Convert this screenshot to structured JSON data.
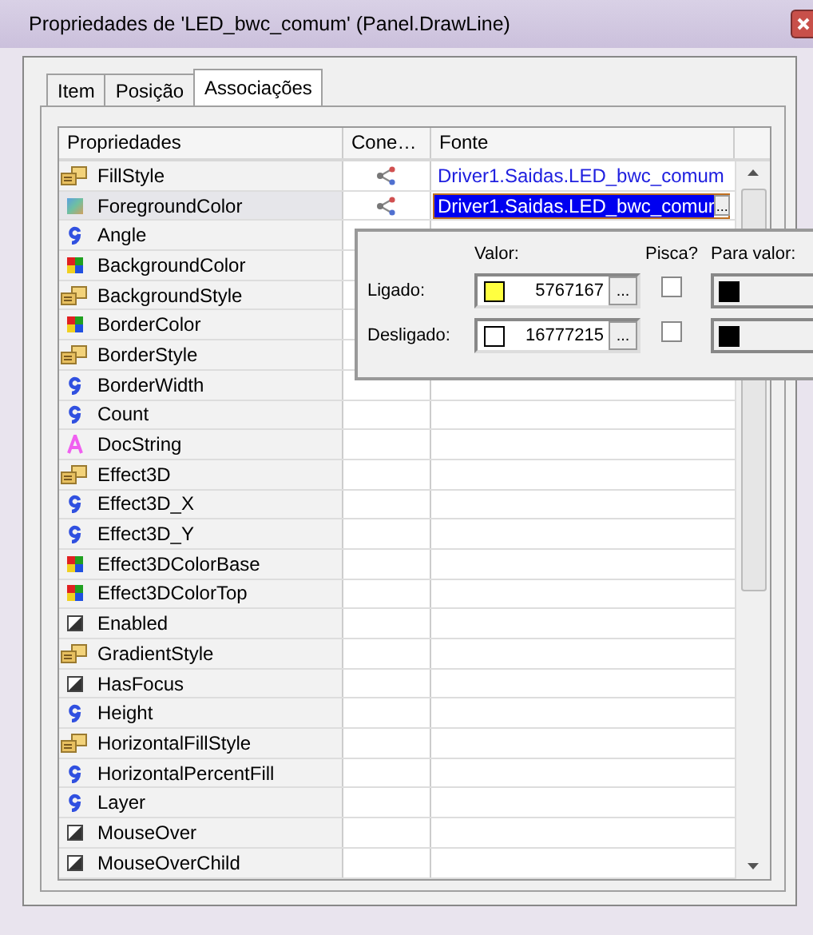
{
  "window": {
    "title": "Propriedades de 'LED_bwc_comum' (Panel.DrawLine)"
  },
  "tabs": [
    {
      "label": "Item",
      "selected": false
    },
    {
      "label": "Posição",
      "selected": false
    },
    {
      "label": "Associações",
      "selected": true
    }
  ],
  "table": {
    "columns": [
      "Propriedades",
      "Cone…",
      "Fonte"
    ],
    "rows": [
      {
        "name": "FillStyle",
        "kind": "style",
        "source": "Driver1.Saidas.LED_bwc_comum",
        "selected": false
      },
      {
        "name": "ForegroundColor",
        "kind": "gradient",
        "source": "Driver1.Saidas.LED_bwc_comur",
        "selected": true
      },
      {
        "name": "Angle",
        "kind": "number",
        "selected": false
      },
      {
        "name": "BackgroundColor",
        "kind": "color",
        "selected": false
      },
      {
        "name": "BackgroundStyle",
        "kind": "style",
        "selected": false
      },
      {
        "name": "BorderColor",
        "kind": "color",
        "selected": false
      },
      {
        "name": "BorderStyle",
        "kind": "style",
        "selected": false
      },
      {
        "name": "BorderWidth",
        "kind": "number",
        "selected": false
      },
      {
        "name": "Count",
        "kind": "number",
        "selected": false
      },
      {
        "name": "DocString",
        "kind": "text",
        "selected": false
      },
      {
        "name": "Effect3D",
        "kind": "style",
        "selected": false
      },
      {
        "name": "Effect3D_X",
        "kind": "number",
        "selected": false
      },
      {
        "name": "Effect3D_Y",
        "kind": "number",
        "selected": false
      },
      {
        "name": "Effect3DColorBase",
        "kind": "color",
        "selected": false
      },
      {
        "name": "Effect3DColorTop",
        "kind": "color",
        "selected": false
      },
      {
        "name": "Enabled",
        "kind": "bool",
        "selected": false
      },
      {
        "name": "GradientStyle",
        "kind": "style",
        "selected": false
      },
      {
        "name": "HasFocus",
        "kind": "bool",
        "selected": false
      },
      {
        "name": "Height",
        "kind": "number",
        "selected": false
      },
      {
        "name": "HorizontalFillStyle",
        "kind": "style",
        "selected": false
      },
      {
        "name": "HorizontalPercentFill",
        "kind": "number",
        "selected": false
      },
      {
        "name": "Layer",
        "kind": "number",
        "selected": false
      },
      {
        "name": "MouseOver",
        "kind": "bool",
        "selected": false
      },
      {
        "name": "MouseOverChild",
        "kind": "bool",
        "selected": false
      }
    ]
  },
  "popup": {
    "value_header": "Valor:",
    "blink_header": "Pisca?",
    "target_header": "Para valor:",
    "rows": [
      {
        "label": "Ligado:",
        "color": "#ffff40",
        "value": "5767167",
        "button": "...",
        "blink": false
      },
      {
        "label": "Desligado:",
        "color": "#ffffff",
        "value": "16777215",
        "button": "...",
        "blink": false
      }
    ]
  },
  "source_button": "..."
}
